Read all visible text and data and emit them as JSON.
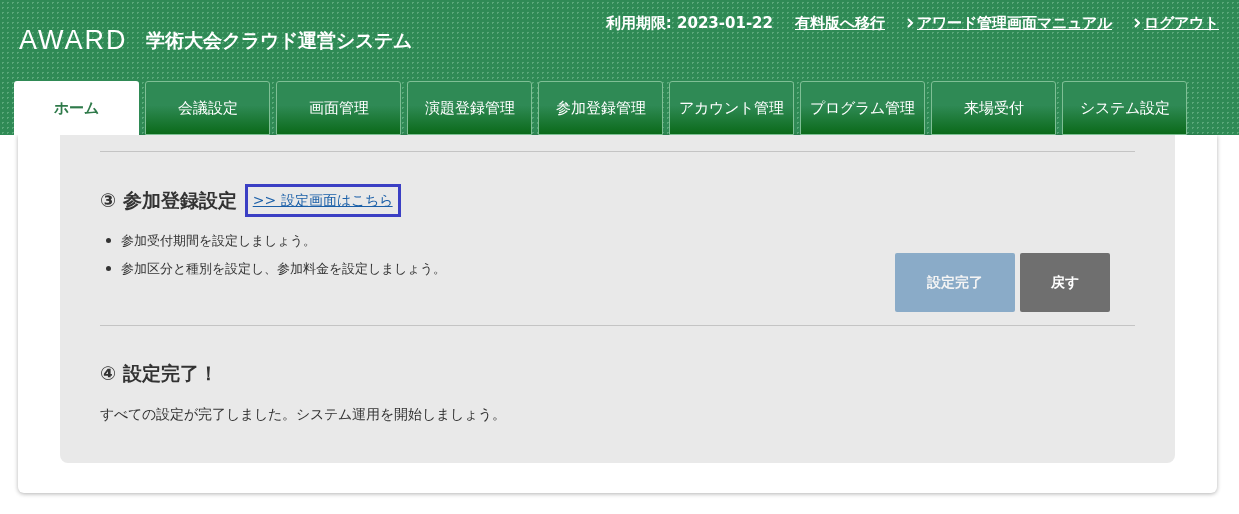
{
  "header": {
    "logo": "AWARD",
    "system_name": "学術大会クラウド運営システム",
    "expiry": "利用期限: 2023-01-22",
    "links": [
      {
        "label": "有料版へ移行",
        "chevron": false
      },
      {
        "label": "アワード管理画面マニュアル",
        "chevron": true
      },
      {
        "label": "ログアウト",
        "chevron": true
      }
    ]
  },
  "tabs": [
    {
      "label": "ホーム",
      "selected": true
    },
    {
      "label": "会議設定",
      "selected": false
    },
    {
      "label": "画面管理",
      "selected": false
    },
    {
      "label": "演題登録管理",
      "selected": false
    },
    {
      "label": "参加登録管理",
      "selected": false
    },
    {
      "label": "アカウント管理",
      "selected": false
    },
    {
      "label": "プログラム管理",
      "selected": false
    },
    {
      "label": "来場受付",
      "selected": false
    },
    {
      "label": "システム設定",
      "selected": false
    }
  ],
  "steps": [
    {
      "title": "③ 参加登録設定",
      "link": ">> 設定画面はこちら",
      "bullets": [
        "参加受付期間を設定しましょう。",
        "参加区分と種別を設定し、参加料金を設定しましょう。"
      ],
      "buttons": [
        {
          "label": "設定完了",
          "kind": "primary",
          "disabled": true
        },
        {
          "label": "戻す",
          "kind": "secondary",
          "disabled": false
        }
      ]
    },
    {
      "title": "④ 設定完了！",
      "text": "すべての設定が完了しました。システム運用を開始しましょう。"
    }
  ]
}
